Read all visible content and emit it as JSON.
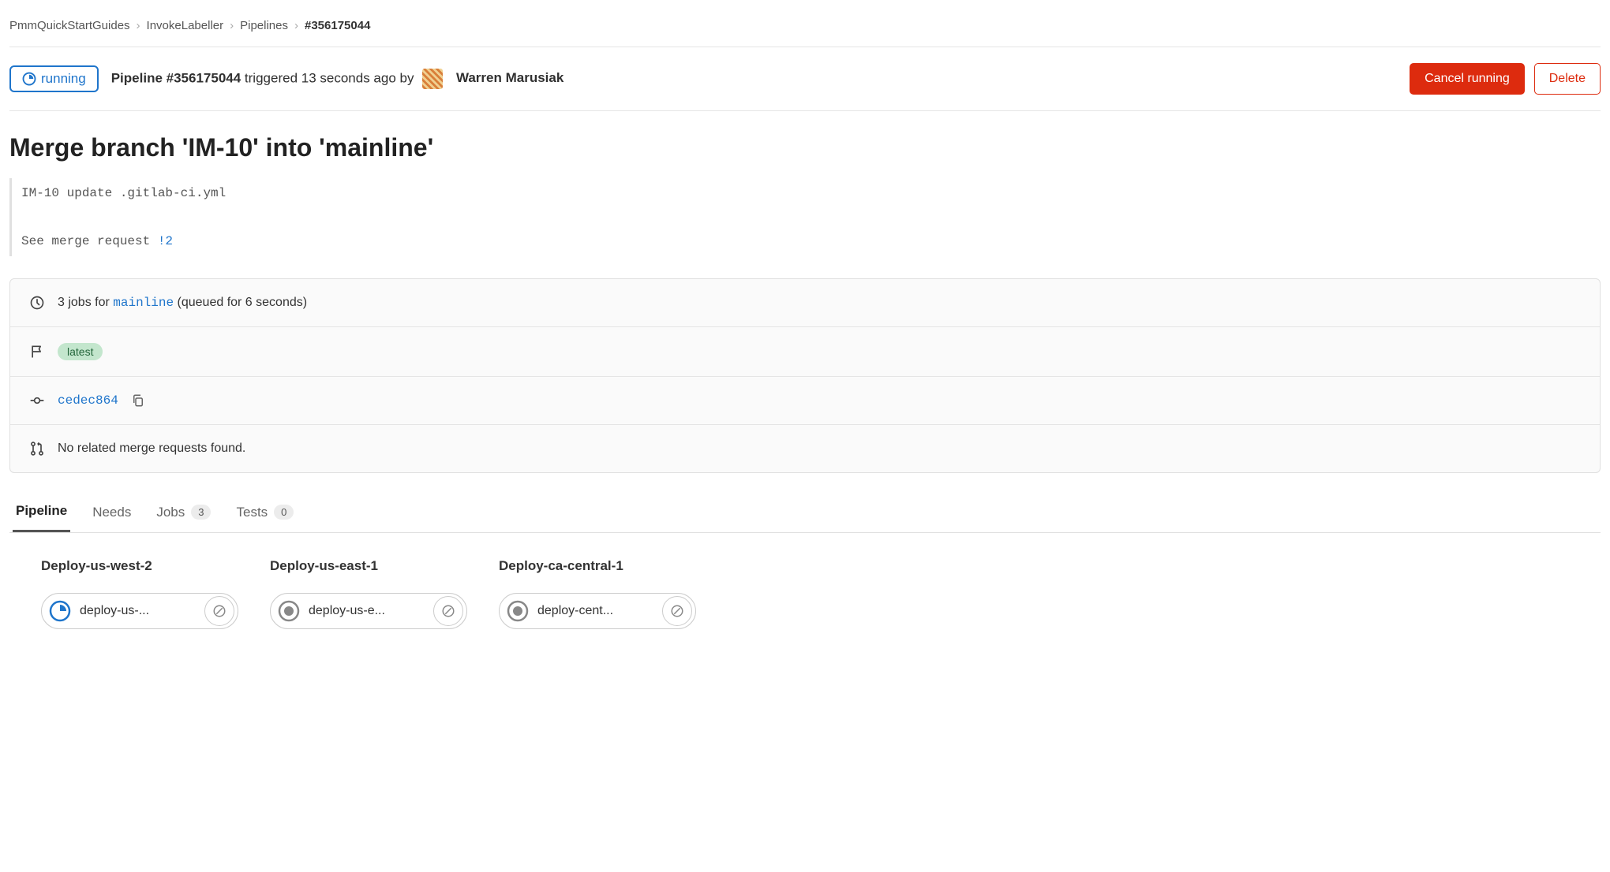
{
  "breadcrumb": {
    "items": [
      "PmmQuickStartGuides",
      "InvokeLabeller",
      "Pipelines",
      "#356175044"
    ]
  },
  "header": {
    "status_label": "running",
    "pipeline_prefix": "Pipeline",
    "pipeline_id": "#356175044",
    "triggered_text": "triggered 13 seconds ago by",
    "author": "Warren Marusiak",
    "cancel_label": "Cancel running",
    "delete_label": "Delete"
  },
  "title": "Merge branch 'IM-10' into 'mainline'",
  "commit": {
    "line1": "IM-10 update .gitlab-ci.yml",
    "line2_prefix": "See merge request ",
    "mr_ref": "!2"
  },
  "info": {
    "jobs_prefix": "3 jobs for ",
    "branch": "mainline",
    "jobs_suffix": " (queued for 6 seconds)",
    "badge": "latest",
    "commit_sha": "cedec864",
    "merge_requests": "No related merge requests found."
  },
  "tabs": [
    {
      "label": "Pipeline",
      "badge": null,
      "active": true
    },
    {
      "label": "Needs",
      "badge": null,
      "active": false
    },
    {
      "label": "Jobs",
      "badge": "3",
      "active": false
    },
    {
      "label": "Tests",
      "badge": "0",
      "active": false
    }
  ],
  "stages": [
    {
      "name": "Deploy-us-west-2",
      "job_label": "deploy-us-...",
      "status": "running"
    },
    {
      "name": "Deploy-us-east-1",
      "job_label": "deploy-us-e...",
      "status": "pending"
    },
    {
      "name": "Deploy-ca-central-1",
      "job_label": "deploy-cent...",
      "status": "pending"
    }
  ]
}
